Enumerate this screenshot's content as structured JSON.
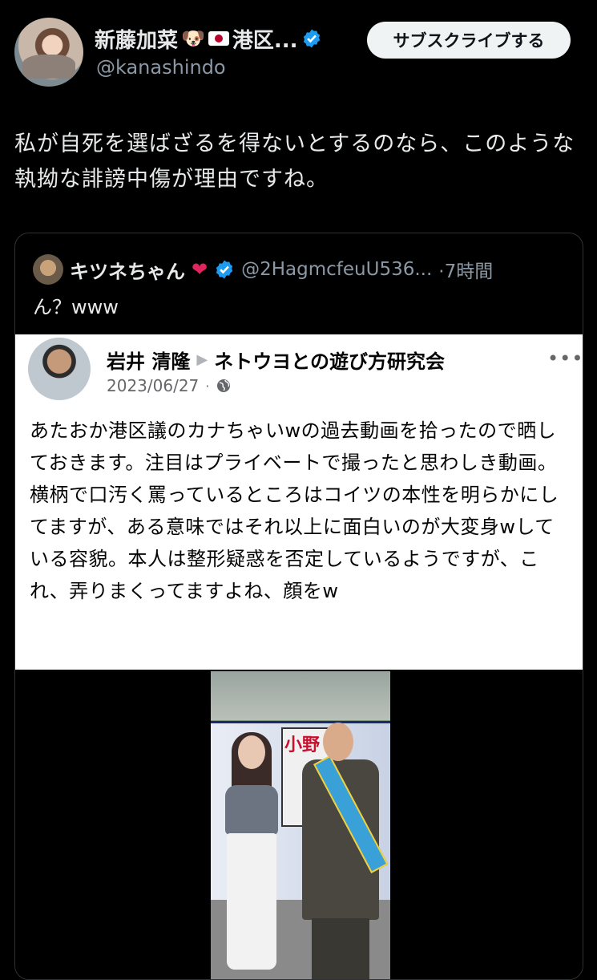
{
  "post": {
    "display_name": "新藤加菜",
    "name_suffix": "港区...",
    "handle": "@kanashindo",
    "subscribe_label": "サブスクライブする",
    "text": "私が自死を選ばざるを得ないとするのなら、このような執拗な誹謗中傷が理由ですね。",
    "icons": [
      "dog-face-icon",
      "japan-flag-icon",
      "verified-badge-icon"
    ]
  },
  "quote": {
    "display_name": "キツネちゃん",
    "handle": "@2HagmcfeuU536...",
    "time": "·7時間",
    "text": "ん？www",
    "icons": [
      "red-heart-icon",
      "verified-badge-icon"
    ]
  },
  "fb_post": {
    "author": "岩井 清隆",
    "arrow": "▶",
    "group": "ネトウヨとの遊び方研究会",
    "date": "2023/06/27",
    "dot": "·",
    "more": "•••",
    "body": "あたおか港区議のカナちゃいwの過去動画を拾ったので晒しておきます。注目はプライベートで撮ったと思わしき動画。横柄で口汚く罵っているところはコイツの本性を明らかにしてますが、ある意味ではそれ以上に面白いのが大変身wしている容貌。本人は整形疑惑を否定しているようですが、これ、弄りまくってますよね、顔をw",
    "icons": [
      "globe-icon",
      "more-options-icon"
    ]
  },
  "video": {
    "poster_text": "小野",
    "colors": {
      "sash": "#3aa0d8",
      "poster_text": "#c8102e"
    }
  },
  "colors": {
    "background": "#000000",
    "text_primary": "#e7e9ea",
    "text_secondary": "#8b98a5",
    "verified": "#1d9bf0",
    "heart": "#e0245e",
    "fb_background": "#ffffff"
  }
}
